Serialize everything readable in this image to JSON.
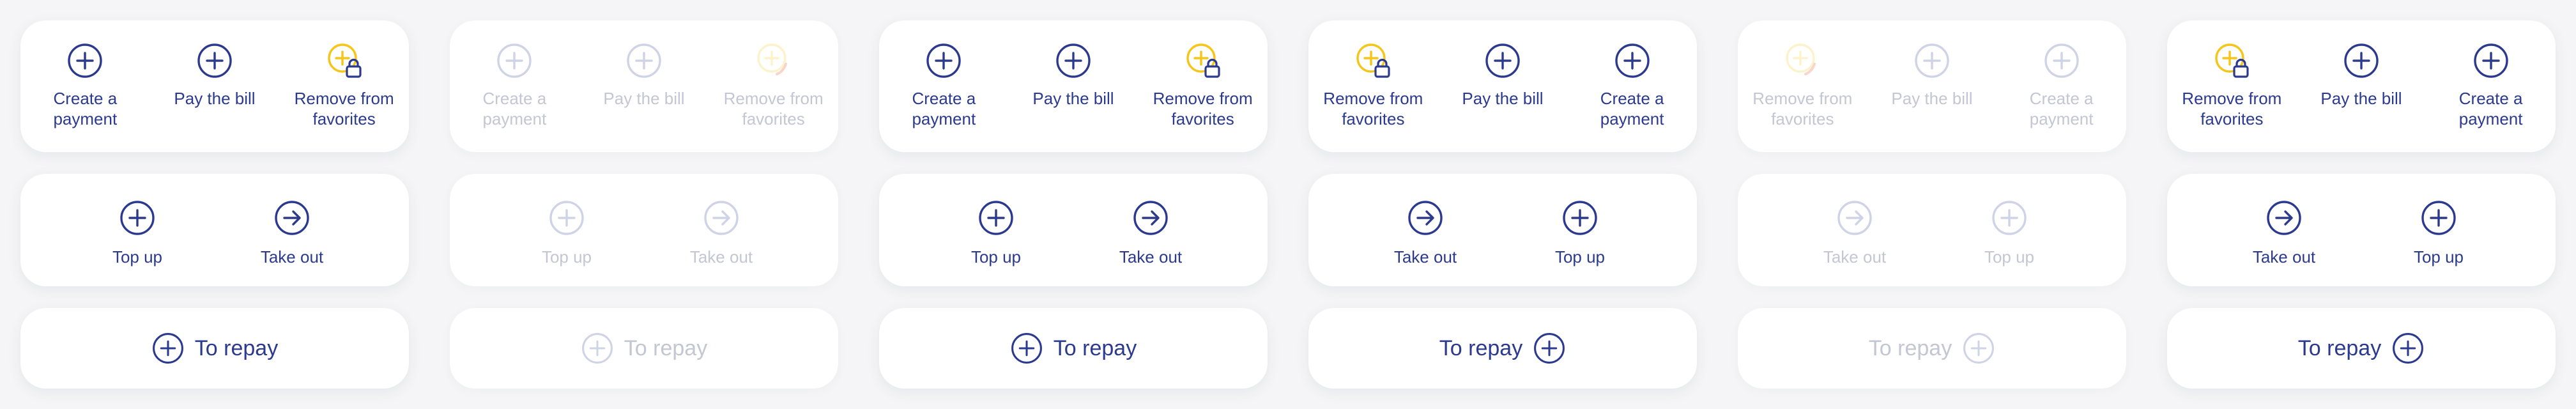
{
  "colors": {
    "accent": "#2b3a8f",
    "highlight": "#f5c518",
    "lock": "#2b3a8f",
    "faded_text": "#c3c6d3"
  },
  "variants": [
    {
      "style": "normal",
      "top": [
        {
          "icon": "plus-circle-icon",
          "label": "Create a\npayment"
        },
        {
          "icon": "plus-circle-icon",
          "label": "Pay the bill"
        },
        {
          "icon": "plus-lock-icon",
          "label": "Remove from\nfavorites"
        }
      ],
      "middle": [
        {
          "icon": "plus-circle-icon",
          "label": "Top up"
        },
        {
          "icon": "arrow-right-circle-icon",
          "label": "Take out"
        }
      ],
      "repay": {
        "label": "To repay",
        "icon_position": "left"
      }
    },
    {
      "style": "faded",
      "top": [
        {
          "icon": "plus-circle-icon",
          "label": "Create a\npayment"
        },
        {
          "icon": "plus-circle-icon",
          "label": "Pay the bill"
        },
        {
          "icon": "loading-icon",
          "label": "Remove from\nfavorites"
        }
      ],
      "middle": [
        {
          "icon": "plus-circle-icon",
          "label": "Top up"
        },
        {
          "icon": "arrow-right-circle-icon",
          "label": "Take out"
        }
      ],
      "repay": {
        "label": "To repay",
        "icon_position": "left"
      }
    },
    {
      "style": "normal",
      "top": [
        {
          "icon": "plus-circle-icon",
          "label": "Create a\npayment"
        },
        {
          "icon": "plus-circle-icon",
          "label": "Pay the bill"
        },
        {
          "icon": "plus-lock-icon",
          "label": "Remove from\nfavorites"
        }
      ],
      "middle": [
        {
          "icon": "plus-circle-icon",
          "label": "Top up"
        },
        {
          "icon": "arrow-right-circle-icon",
          "label": "Take out"
        }
      ],
      "repay": {
        "label": "To repay",
        "icon_position": "left"
      }
    },
    {
      "style": "normal",
      "top": [
        {
          "icon": "plus-lock-icon",
          "label": "Remove from\nfavorites"
        },
        {
          "icon": "plus-circle-icon",
          "label": "Pay the bill"
        },
        {
          "icon": "plus-circle-icon",
          "label": "Create a\npayment"
        }
      ],
      "middle": [
        {
          "icon": "arrow-right-circle-icon",
          "label": "Take out"
        },
        {
          "icon": "plus-circle-icon",
          "label": "Top up"
        }
      ],
      "repay": {
        "label": "To repay",
        "icon_position": "right"
      }
    },
    {
      "style": "faded",
      "top": [
        {
          "icon": "loading-icon",
          "label": "Remove from\nfavorites"
        },
        {
          "icon": "plus-circle-icon",
          "label": "Pay the bill"
        },
        {
          "icon": "plus-circle-icon",
          "label": "Create a\npayment"
        }
      ],
      "middle": [
        {
          "icon": "arrow-right-circle-icon",
          "label": "Take out"
        },
        {
          "icon": "plus-circle-icon",
          "label": "Top up"
        }
      ],
      "repay": {
        "label": "To repay",
        "icon_position": "right"
      }
    },
    {
      "style": "normal",
      "top": [
        {
          "icon": "plus-lock-icon",
          "label": "Remove from\nfavorites"
        },
        {
          "icon": "plus-circle-icon",
          "label": "Pay the bill"
        },
        {
          "icon": "plus-circle-icon",
          "label": "Create a\npayment"
        }
      ],
      "middle": [
        {
          "icon": "arrow-right-circle-icon",
          "label": "Take out"
        },
        {
          "icon": "plus-circle-icon",
          "label": "Top up"
        }
      ],
      "repay": {
        "label": "To repay",
        "icon_position": "right"
      }
    }
  ]
}
